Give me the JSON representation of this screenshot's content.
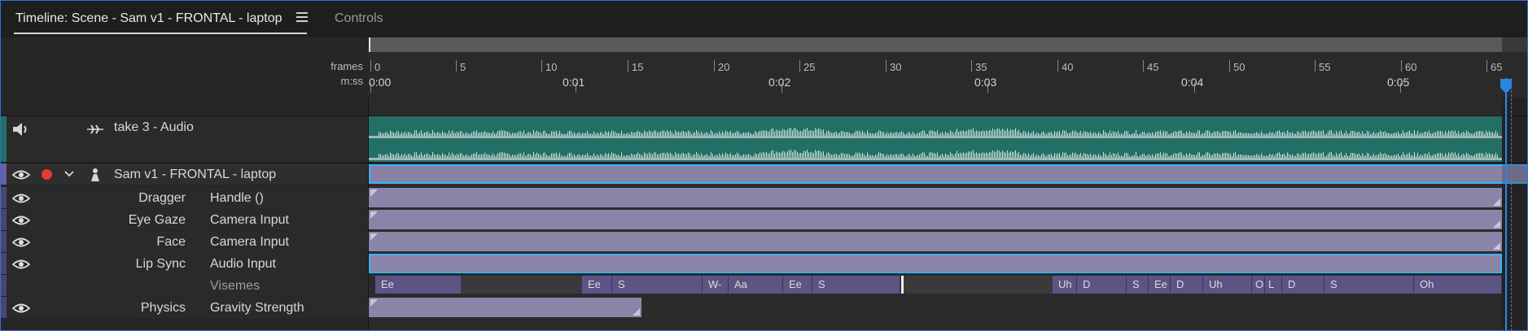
{
  "tabs": {
    "active_label": "Timeline: Scene - Sam v1 - FRONTAL - laptop",
    "inactive_label": "Controls"
  },
  "ruler": {
    "frames_label": "frames",
    "time_label": "m:ss",
    "frame_ticks": [
      "0",
      "5",
      "10",
      "15",
      "20",
      "25",
      "30",
      "35",
      "40",
      "45",
      "50",
      "55",
      "60",
      "65"
    ],
    "time_ticks": [
      "0:00",
      "0:01",
      "0:02",
      "0:03",
      "0:04",
      "0:05"
    ]
  },
  "audio_track": {
    "name": "take 3 - Audio"
  },
  "puppet_track": {
    "name": "Sam v1 - FRONTAL - laptop"
  },
  "behaviors": [
    {
      "name": "Dragger",
      "param": "Handle ()"
    },
    {
      "name": "Eye Gaze",
      "param": "Camera Input"
    },
    {
      "name": "Face",
      "param": "Camera Input"
    },
    {
      "name": "Lip Sync",
      "param": "Audio Input"
    },
    {
      "name": "",
      "param": "Visemes"
    },
    {
      "name": "Physics",
      "param": "Gravity Strength"
    }
  ],
  "visemes": [
    "Ee",
    "Ee",
    "S",
    "W-",
    "Aa",
    "Ee",
    "S",
    "Uh",
    "D",
    "S",
    "Ee",
    "D",
    "Uh",
    "O",
    "L",
    "D",
    "S",
    "Oh"
  ],
  "colors": {
    "accent": "#3bb0ff",
    "audio_clip": "#236f66",
    "behavior_clip": "#8a85a8",
    "viseme_block": "#5d5384",
    "record": "#e53935",
    "playhead": "#2a86e2"
  }
}
